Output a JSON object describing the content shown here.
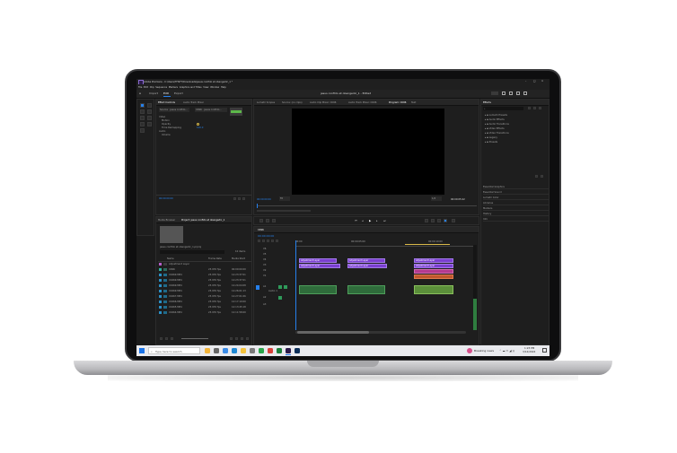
{
  "app": {
    "title": "Adobe Premiere - C:\\Users\\THSTT\\Downloads\\jesus confido et obengedic_1 *",
    "project_name": "jesus confido et obengedic_1 - Edited",
    "menu": [
      "File",
      "Edit",
      "Clip",
      "Sequence",
      "Markers",
      "Graphics and Titles",
      "View",
      "Window",
      "Help"
    ],
    "workspaces": [
      "Import",
      "Edit",
      "Export"
    ]
  },
  "effect_controls": {
    "tabs": [
      "Effect Controls",
      "Audio Track Mixer"
    ],
    "source_label": "Source · jesus confido...",
    "seq_label": "CK96 · jesus confido...",
    "sections": [
      "Video",
      "Motion",
      "Opacity",
      "Time Remapping",
      "Audio",
      "Volume"
    ],
    "timecode": "00:00:00:00"
  },
  "program_monitor": {
    "tabs": [
      "Lumetri Scopes",
      "Source: (no clips)",
      "Audio Clip Mixer: CK96",
      "Audio Track Mixer: CK96",
      "Program: CK96",
      "Text"
    ],
    "timecode_left": "00:00:00:00",
    "fit": "Fit",
    "quality": "1/2",
    "timecode_right": "00:00:05:22"
  },
  "project_panel": {
    "tabs": [
      "Media Browser",
      "Project: jesus confido et obengedic_1"
    ],
    "project_file": "jesus confido et obengedic_1.prproj",
    "item_count": "10 items",
    "columns": [
      "Name",
      "Frame Rate",
      "Media Start"
    ],
    "items": [
      {
        "name": "Adjustment Layer",
        "rate": "",
        "start": ""
      },
      {
        "name": "CK96",
        "rate": "23.976 fps",
        "start": "00:00:00:00"
      },
      {
        "name": "C0469.MP4",
        "rate": "23.976 fps",
        "start": "12:23:37:01"
      },
      {
        "name": "C0469.MP4",
        "rate": "23.976 fps",
        "start": "12:23:37:01"
      },
      {
        "name": "C0469.MP4",
        "rate": "23.976 fps",
        "start": "12:24:04:08"
      },
      {
        "name": "C0469.MP4",
        "rate": "23.976 fps",
        "start": "12:26:01:13"
      },
      {
        "name": "C0467.MP4",
        "rate": "23.976 fps",
        "start": "12:27:01:06"
      },
      {
        "name": "C0466.MP4",
        "rate": "23.976 fps",
        "start": "12:17:19:00"
      },
      {
        "name": "C0465.MP4",
        "rate": "23.976 fps",
        "start": "12:13:45:18"
      },
      {
        "name": "C0464.MP4",
        "rate": "23.976 fps",
        "start": "12:11:58:00"
      }
    ]
  },
  "timeline": {
    "sequence_tab": "CK96",
    "timecode": "00:00:00:00",
    "ruler": [
      "00:00",
      "00:00:05:00",
      "00:00:10:00"
    ],
    "clip_labels": [
      "Adjustment Layer",
      "Adjustment Layer",
      "Adjustment Layer",
      "Adjustment Layer",
      "Adjustment Layer",
      "Adjustment Layer"
    ],
    "track_names": [
      "V6",
      "V5",
      "V4",
      "V3",
      "V2",
      "V1",
      "A1",
      "A2",
      "A3"
    ],
    "audio_label": "Audio 1"
  },
  "effects_panel": {
    "title": "Effects",
    "folders": [
      "Lumetri Presets",
      "Audio Effects",
      "Audio Transitions",
      "Video Effects",
      "Video Transitions",
      "Legacy",
      "Presets"
    ],
    "top_item": "Lumetri Presets",
    "panels": [
      "Essential Graphics",
      "Essential Sound",
      "Lumetri Color",
      "Libraries",
      "Markers",
      "History",
      "Info"
    ]
  },
  "taskbar": {
    "search_placeholder": "Type here to search",
    "news": "Breaking news",
    "time": "1:23 PM",
    "date": "3/12/2024"
  },
  "colors": {
    "accent": "#2680eb",
    "adjustment_clip": "#7b3fd1",
    "video_clip": "#b43a8f",
    "audio_clip": "#2f6c3b"
  }
}
